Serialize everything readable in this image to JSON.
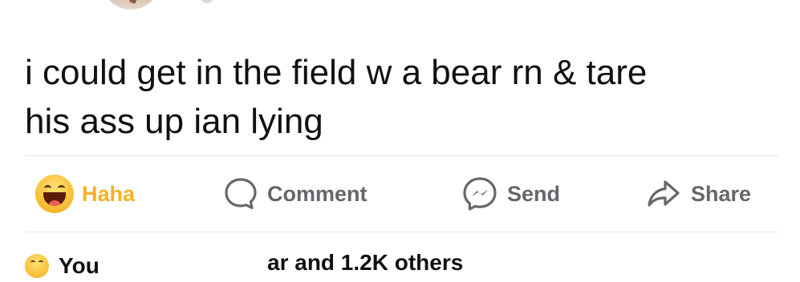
{
  "post": {
    "text": "i could get in the field w a bear rn & tare\nhis ass up ian lying"
  },
  "actions": {
    "reaction_label": "Haha",
    "comment_label": "Comment",
    "send_label": "Send",
    "share_label": "Share"
  },
  "reactions_summary": {
    "you_text": "You",
    "others_text": "ar and 1.2K others"
  },
  "colors": {
    "haha_accent": "#f7b125",
    "action_gray": "#65676b",
    "divider": "#e6e6e6",
    "text": "#111111"
  },
  "icons": {
    "reaction": "haha-emoji-icon",
    "comment": "comment-bubble-icon",
    "send": "messenger-icon",
    "share": "share-arrow-icon"
  }
}
